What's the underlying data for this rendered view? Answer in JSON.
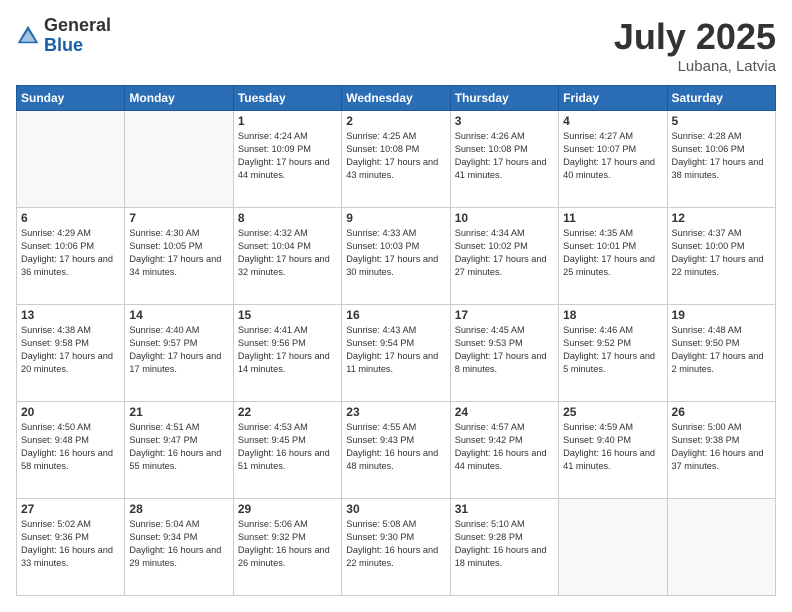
{
  "header": {
    "logo": {
      "general": "General",
      "blue": "Blue"
    },
    "title": "July 2025",
    "location": "Lubana, Latvia"
  },
  "days_header": [
    "Sunday",
    "Monday",
    "Tuesday",
    "Wednesday",
    "Thursday",
    "Friday",
    "Saturday"
  ],
  "weeks": [
    [
      {
        "day": "",
        "empty": true
      },
      {
        "day": "",
        "empty": true
      },
      {
        "day": "1",
        "sunrise": "Sunrise: 4:24 AM",
        "sunset": "Sunset: 10:09 PM",
        "daylight": "Daylight: 17 hours and 44 minutes."
      },
      {
        "day": "2",
        "sunrise": "Sunrise: 4:25 AM",
        "sunset": "Sunset: 10:08 PM",
        "daylight": "Daylight: 17 hours and 43 minutes."
      },
      {
        "day": "3",
        "sunrise": "Sunrise: 4:26 AM",
        "sunset": "Sunset: 10:08 PM",
        "daylight": "Daylight: 17 hours and 41 minutes."
      },
      {
        "day": "4",
        "sunrise": "Sunrise: 4:27 AM",
        "sunset": "Sunset: 10:07 PM",
        "daylight": "Daylight: 17 hours and 40 minutes."
      },
      {
        "day": "5",
        "sunrise": "Sunrise: 4:28 AM",
        "sunset": "Sunset: 10:06 PM",
        "daylight": "Daylight: 17 hours and 38 minutes."
      }
    ],
    [
      {
        "day": "6",
        "sunrise": "Sunrise: 4:29 AM",
        "sunset": "Sunset: 10:06 PM",
        "daylight": "Daylight: 17 hours and 36 minutes."
      },
      {
        "day": "7",
        "sunrise": "Sunrise: 4:30 AM",
        "sunset": "Sunset: 10:05 PM",
        "daylight": "Daylight: 17 hours and 34 minutes."
      },
      {
        "day": "8",
        "sunrise": "Sunrise: 4:32 AM",
        "sunset": "Sunset: 10:04 PM",
        "daylight": "Daylight: 17 hours and 32 minutes."
      },
      {
        "day": "9",
        "sunrise": "Sunrise: 4:33 AM",
        "sunset": "Sunset: 10:03 PM",
        "daylight": "Daylight: 17 hours and 30 minutes."
      },
      {
        "day": "10",
        "sunrise": "Sunrise: 4:34 AM",
        "sunset": "Sunset: 10:02 PM",
        "daylight": "Daylight: 17 hours and 27 minutes."
      },
      {
        "day": "11",
        "sunrise": "Sunrise: 4:35 AM",
        "sunset": "Sunset: 10:01 PM",
        "daylight": "Daylight: 17 hours and 25 minutes."
      },
      {
        "day": "12",
        "sunrise": "Sunrise: 4:37 AM",
        "sunset": "Sunset: 10:00 PM",
        "daylight": "Daylight: 17 hours and 22 minutes."
      }
    ],
    [
      {
        "day": "13",
        "sunrise": "Sunrise: 4:38 AM",
        "sunset": "Sunset: 9:58 PM",
        "daylight": "Daylight: 17 hours and 20 minutes."
      },
      {
        "day": "14",
        "sunrise": "Sunrise: 4:40 AM",
        "sunset": "Sunset: 9:57 PM",
        "daylight": "Daylight: 17 hours and 17 minutes."
      },
      {
        "day": "15",
        "sunrise": "Sunrise: 4:41 AM",
        "sunset": "Sunset: 9:56 PM",
        "daylight": "Daylight: 17 hours and 14 minutes."
      },
      {
        "day": "16",
        "sunrise": "Sunrise: 4:43 AM",
        "sunset": "Sunset: 9:54 PM",
        "daylight": "Daylight: 17 hours and 11 minutes."
      },
      {
        "day": "17",
        "sunrise": "Sunrise: 4:45 AM",
        "sunset": "Sunset: 9:53 PM",
        "daylight": "Daylight: 17 hours and 8 minutes."
      },
      {
        "day": "18",
        "sunrise": "Sunrise: 4:46 AM",
        "sunset": "Sunset: 9:52 PM",
        "daylight": "Daylight: 17 hours and 5 minutes."
      },
      {
        "day": "19",
        "sunrise": "Sunrise: 4:48 AM",
        "sunset": "Sunset: 9:50 PM",
        "daylight": "Daylight: 17 hours and 2 minutes."
      }
    ],
    [
      {
        "day": "20",
        "sunrise": "Sunrise: 4:50 AM",
        "sunset": "Sunset: 9:48 PM",
        "daylight": "Daylight: 16 hours and 58 minutes."
      },
      {
        "day": "21",
        "sunrise": "Sunrise: 4:51 AM",
        "sunset": "Sunset: 9:47 PM",
        "daylight": "Daylight: 16 hours and 55 minutes."
      },
      {
        "day": "22",
        "sunrise": "Sunrise: 4:53 AM",
        "sunset": "Sunset: 9:45 PM",
        "daylight": "Daylight: 16 hours and 51 minutes."
      },
      {
        "day": "23",
        "sunrise": "Sunrise: 4:55 AM",
        "sunset": "Sunset: 9:43 PM",
        "daylight": "Daylight: 16 hours and 48 minutes."
      },
      {
        "day": "24",
        "sunrise": "Sunrise: 4:57 AM",
        "sunset": "Sunset: 9:42 PM",
        "daylight": "Daylight: 16 hours and 44 minutes."
      },
      {
        "day": "25",
        "sunrise": "Sunrise: 4:59 AM",
        "sunset": "Sunset: 9:40 PM",
        "daylight": "Daylight: 16 hours and 41 minutes."
      },
      {
        "day": "26",
        "sunrise": "Sunrise: 5:00 AM",
        "sunset": "Sunset: 9:38 PM",
        "daylight": "Daylight: 16 hours and 37 minutes."
      }
    ],
    [
      {
        "day": "27",
        "sunrise": "Sunrise: 5:02 AM",
        "sunset": "Sunset: 9:36 PM",
        "daylight": "Daylight: 16 hours and 33 minutes."
      },
      {
        "day": "28",
        "sunrise": "Sunrise: 5:04 AM",
        "sunset": "Sunset: 9:34 PM",
        "daylight": "Daylight: 16 hours and 29 minutes."
      },
      {
        "day": "29",
        "sunrise": "Sunrise: 5:06 AM",
        "sunset": "Sunset: 9:32 PM",
        "daylight": "Daylight: 16 hours and 26 minutes."
      },
      {
        "day": "30",
        "sunrise": "Sunrise: 5:08 AM",
        "sunset": "Sunset: 9:30 PM",
        "daylight": "Daylight: 16 hours and 22 minutes."
      },
      {
        "day": "31",
        "sunrise": "Sunrise: 5:10 AM",
        "sunset": "Sunset: 9:28 PM",
        "daylight": "Daylight: 16 hours and 18 minutes."
      },
      {
        "day": "",
        "empty": true
      },
      {
        "day": "",
        "empty": true
      }
    ]
  ]
}
